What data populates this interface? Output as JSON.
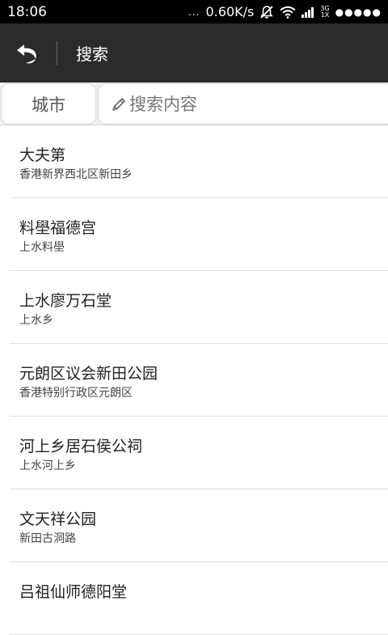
{
  "status_bar": {
    "time": "18:06",
    "dots": "...",
    "speed": "0.60K/s",
    "network_top": "3G",
    "network_bottom": "1X",
    "signal_dots": "●●●●●"
  },
  "app_bar": {
    "title": "搜索"
  },
  "search": {
    "city_label": "城市",
    "placeholder": "搜索内容"
  },
  "results": [
    {
      "title": "大夫第",
      "subtitle": "香港新界西北区新田乡"
    },
    {
      "title": "料壆福德宫",
      "subtitle": "上水料壆"
    },
    {
      "title": "上水廖万石堂",
      "subtitle": "上水乡"
    },
    {
      "title": "元朗区议会新田公园",
      "subtitle": "香港特别行政区元朗区"
    },
    {
      "title": "河上乡居石侯公祠",
      "subtitle": "上水河上乡"
    },
    {
      "title": "文天祥公园",
      "subtitle": "新田古洞路"
    },
    {
      "title": "吕祖仙师德阳堂",
      "subtitle": ""
    }
  ]
}
